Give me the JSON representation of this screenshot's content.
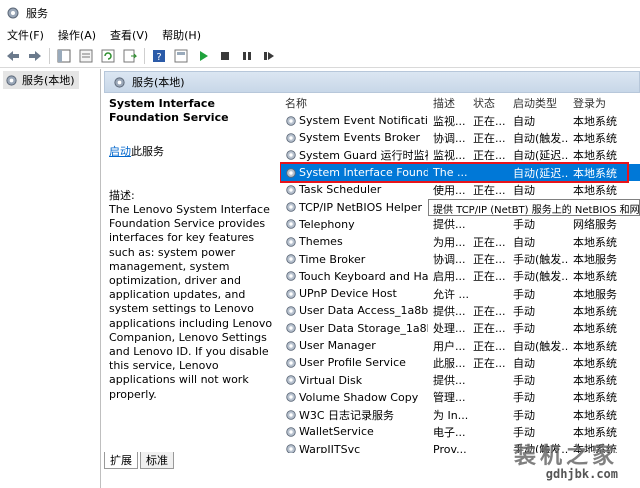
{
  "window": {
    "title": "服务"
  },
  "menu": [
    "文件(F)",
    "操作(A)",
    "查看(V)",
    "帮助(H)"
  ],
  "toolbar": {
    "icons": [
      "back-arrow-icon",
      "forward-arrow-icon",
      "show-hide-tree-icon",
      "properties-icon",
      "refresh-icon",
      "export-list-icon",
      "help-icon",
      "console-icon",
      "play-icon",
      "stop-icon",
      "pause-icon",
      "restart-icon"
    ],
    "colors": {
      "play": "#1fa23c",
      "stop": "#3a3a3a"
    }
  },
  "tree": {
    "item": "服务(本地)"
  },
  "main_header": {
    "label": "服务(本地)"
  },
  "details": {
    "service_title": "System Interface Foundation Service",
    "start_link": "启动",
    "start_suffix": "此服务",
    "desc_label": "描述:",
    "desc_body": "The Lenovo System Interface Foundation Service provides interfaces for key features such as: system power management, system optimization, driver and application updates, and system settings to Lenovo applications including Lenovo Companion, Lenovo Settings and Lenovo ID. If you disable this service, Lenovo applications will not work properly."
  },
  "list": {
    "columns": [
      "名称",
      "描述",
      "状态",
      "启动类型",
      "登录为"
    ],
    "rows": [
      {
        "name": "System Event Notification...",
        "desc": "监视...",
        "status": "正在...",
        "type": "自动",
        "logon": "本地系统"
      },
      {
        "name": "System Events Broker",
        "desc": "协调...",
        "status": "正在...",
        "type": "自动(触发...",
        "logon": "本地系统"
      },
      {
        "name": "System Guard 运行时监视...",
        "desc": "监视...",
        "status": "正在...",
        "type": "自动(延迟...",
        "logon": "本地系统"
      },
      {
        "name": "System Interface Foundat...",
        "desc": "The ...",
        "status": "",
        "type": "自动(延迟...",
        "logon": "本地系统"
      },
      {
        "name": "Task Scheduler",
        "desc": "使用...",
        "status": "正在...",
        "type": "自动",
        "logon": "本地系统"
      },
      {
        "name": "TCP/IP NetBIOS Helper",
        "desc": "",
        "status": "",
        "type": "",
        "logon": ""
      },
      {
        "name": "Telephony",
        "desc": "提供...",
        "status": "",
        "type": "手动",
        "logon": "网络服务"
      },
      {
        "name": "Themes",
        "desc": "为用...",
        "status": "正在...",
        "type": "自动",
        "logon": "本地系统"
      },
      {
        "name": "Time Broker",
        "desc": "协调...",
        "status": "正在...",
        "type": "手动(触发...",
        "logon": "本地服务"
      },
      {
        "name": "Touch Keyboard and Ha...",
        "desc": "启用...",
        "status": "正在...",
        "type": "手动(触发...",
        "logon": "本地系统"
      },
      {
        "name": "UPnP Device Host",
        "desc": "允许 ...",
        "status": "",
        "type": "手动",
        "logon": "本地服务"
      },
      {
        "name": "User Data Access_1a8b85a",
        "desc": "提供...",
        "status": "正在...",
        "type": "手动",
        "logon": "本地系统"
      },
      {
        "name": "User Data Storage_1a8b...",
        "desc": "处理...",
        "status": "正在...",
        "type": "手动",
        "logon": "本地系统"
      },
      {
        "name": "User Manager",
        "desc": "用户...",
        "status": "正在...",
        "type": "自动(触发...",
        "logon": "本地系统"
      },
      {
        "name": "User Profile Service",
        "desc": "此服...",
        "status": "正在...",
        "type": "自动",
        "logon": "本地系统"
      },
      {
        "name": "Virtual Disk",
        "desc": "提供...",
        "status": "",
        "type": "手动",
        "logon": "本地系统"
      },
      {
        "name": "Volume Shadow Copy",
        "desc": "管理...",
        "status": "",
        "type": "手动",
        "logon": "本地系统"
      },
      {
        "name": "W3C 日志记录服务",
        "desc": "为 In...",
        "status": "",
        "type": "手动",
        "logon": "本地系统"
      },
      {
        "name": "WalletService",
        "desc": "电子...",
        "status": "",
        "type": "手动",
        "logon": "本地系统"
      },
      {
        "name": "WarpJITSvc",
        "desc": "Prov...",
        "status": "",
        "type": "手动(触发...",
        "logon": "本地系统"
      }
    ],
    "selected_index": 3,
    "highlight_color": "#e8141b",
    "selection_color": "#0078d7"
  },
  "tooltip": {
    "text": "提供 TCP/IP (NetBT) 服务上的 NetBIOS 和网络"
  },
  "tabs": [
    "扩展",
    "标准"
  ],
  "watermark": {
    "title": "装机之家",
    "url": "gdhjbk.com"
  }
}
